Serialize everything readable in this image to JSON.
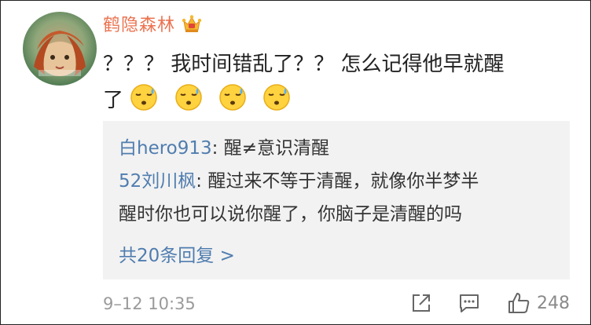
{
  "comment": {
    "username": "鹤隐森林",
    "badge_icon": "crown-vip-icon",
    "text_line1": "？？？ 我时间错乱了？？ 怎么记得他早就醒",
    "text_line2": "了",
    "emojis": [
      "sleepy-sweat-emoji",
      "sleepy-sweat-emoji",
      "sleepy-sweat-emoji",
      "sleepy-sweat-emoji"
    ]
  },
  "replies": [
    {
      "user": "白hero913",
      "separator": ":",
      "text": " 醒≠意识清醒"
    },
    {
      "user": "52刘川枫",
      "separator": ":",
      "text": " 醒过来不等于清醒，就像你半梦半",
      "continuation": "醒时你也可以说你醒了，你脑子是清醒的吗"
    }
  ],
  "more_replies_label": "共20条回复 >",
  "footer": {
    "timestamp": "9–12 10:35",
    "like_count": "248"
  },
  "colors": {
    "username": "#eb7350",
    "link": "#507daf",
    "reply_bg": "#f2f2f2",
    "meta_text": "#9a9a9a"
  }
}
